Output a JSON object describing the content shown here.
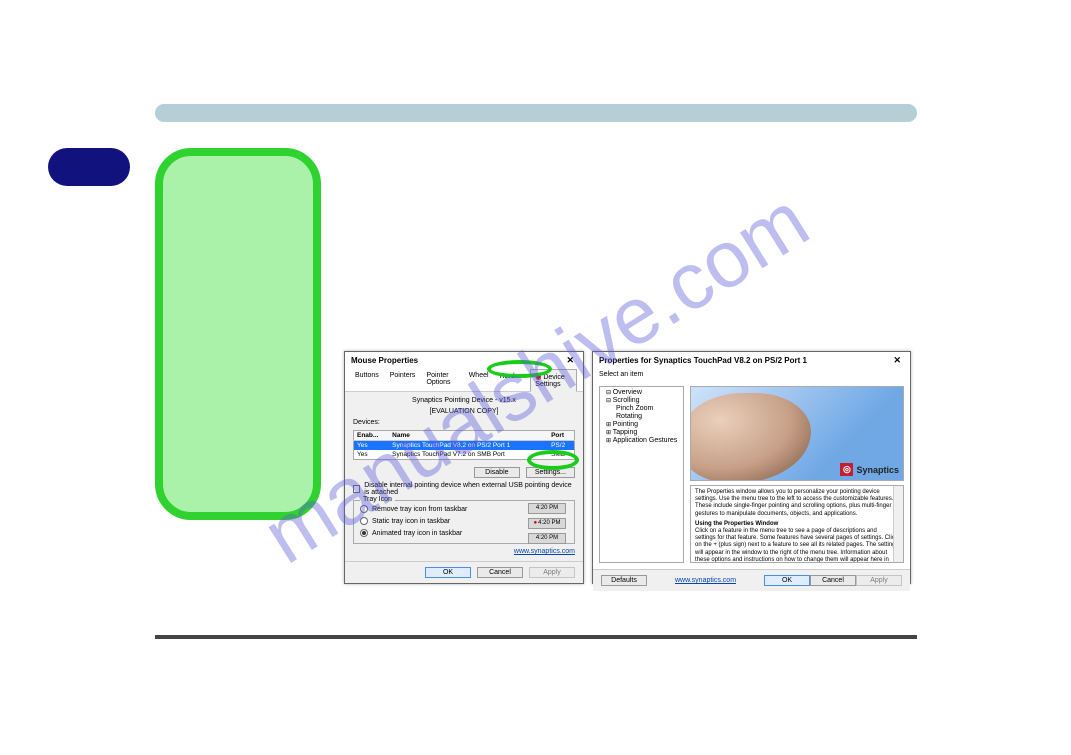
{
  "watermark": "manualshive.com",
  "mouse_dialog": {
    "title": "Mouse Properties",
    "close": "✕",
    "tabs": [
      "Buttons",
      "Pointers",
      "Pointer Options",
      "Wheel",
      "Hardw▸"
    ],
    "active_tab": "Device Settings",
    "heading_line1": "Synaptics Pointing Device - v15.x",
    "heading_line2": "[EVALUATION COPY]",
    "devices_label": "Devices:",
    "table": {
      "headers": [
        "Enab...",
        "Name",
        "Port"
      ],
      "rows": [
        {
          "enabled": "Yes",
          "name": "Synaptics TouchPad V8.2 on PS/2 Port 1",
          "port": "PS/2",
          "selected": true
        },
        {
          "enabled": "Yes",
          "name": "Synaptics TouchPad V7.2 on SMB Port",
          "port": "SMB",
          "selected": false
        }
      ]
    },
    "buttons": {
      "disable": "Disable",
      "settings": "Settings..."
    },
    "usb_checkbox": "Disable internal pointing device when external USB pointing device is attached",
    "tray": {
      "title": "Tray Icon",
      "radios": [
        "Remove tray icon from taskbar",
        "Static tray icon in taskbar",
        "Animated tray icon in taskbar"
      ],
      "selected": 2,
      "time": "4:20 PM"
    },
    "link": "www.synaptics.com",
    "footer": {
      "ok": "OK",
      "cancel": "Cancel",
      "apply": "Apply"
    }
  },
  "props_dialog": {
    "title": "Properties for Synaptics TouchPad V8.2 on PS/2 Port 1",
    "close": "✕",
    "tree_title": "Select an item",
    "tree": {
      "overview": "Overview",
      "scrolling": "Scrolling",
      "pinch_zoom": "Pinch Zoom",
      "rotating": "Rotating",
      "pointing": "Pointing",
      "tapping": "Tapping",
      "app_gestures": "Application Gestures"
    },
    "brand": "Synaptics",
    "info_heading": "Using the Properties Window",
    "info_text1": "The Properties window allows you to personalize your pointing device settings. Use the menu tree to the left to access the customizable features. These include single-finger pointing and scrolling options, plus multi-finger gestures to manipulate documents, objects, and applications.",
    "info_text2": "Click on a feature in the menu tree to see a page of descriptions and settings for that feature. Some features have several pages of settings. Click on the + (plus sign) next to a feature to see all its related pages. The settings will appear in the window to the right of the menu tree. Information about these options and instructions on how to change them will appear here in this information box. You can use the scroll bar to view the contents of the information box.",
    "footer": {
      "defaults": "Defaults",
      "link": "www.synaptics.com",
      "ok": "OK",
      "cancel": "Cancel",
      "apply": "Apply"
    }
  }
}
